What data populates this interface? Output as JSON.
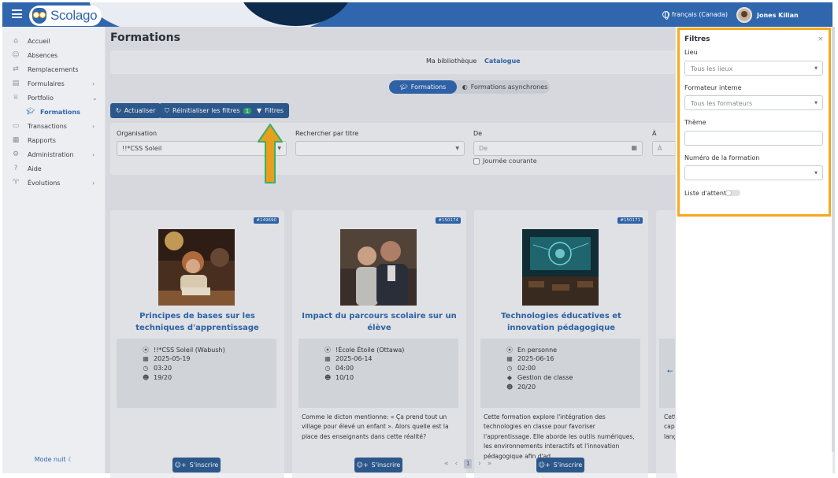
{
  "header": {
    "logo_text": "Scolago",
    "language": "français (Canada)",
    "user_name": "Jones Kilian"
  },
  "sidebar": {
    "items": [
      {
        "label": "Accueil",
        "icon": "home-icon"
      },
      {
        "label": "Absences",
        "icon": "users-icon"
      },
      {
        "label": "Remplacements",
        "icon": "swap-icon"
      },
      {
        "label": "Formulaires",
        "icon": "file-icon"
      },
      {
        "label": "Portfolio",
        "icon": "trophy-icon"
      },
      {
        "label": "Formations",
        "icon": "graduation-cap-icon"
      },
      {
        "label": "Transactions",
        "icon": "transaction-icon"
      },
      {
        "label": "Rapports",
        "icon": "report-icon"
      },
      {
        "label": "Administration",
        "icon": "gear-icon"
      },
      {
        "label": "Aide",
        "icon": "help-icon"
      },
      {
        "label": "Évolutions",
        "icon": "evolution-icon"
      }
    ],
    "mode_nuit": "Mode nuit ☾"
  },
  "page": {
    "title": "Formations",
    "library_link": "Ma bibliothèque",
    "catalogue_link": "Catalogue",
    "toggle": {
      "active": "Formations",
      "inactive": "Formations asynchrones"
    },
    "buttons": {
      "refresh": "Actualiser",
      "reset": "Réinitialiser les filtres",
      "reset_count": "1",
      "filters": "Filtres"
    },
    "filters": {
      "org_label": "Organisation",
      "org_value": "!!*CSS Soleil",
      "search_label": "Rechercher par titre",
      "search_value": "",
      "from_label": "De",
      "from_placeholder": "De",
      "to_label": "À",
      "to_placeholder": "À",
      "current_day": "Journée courante"
    }
  },
  "cards": [
    {
      "number": "#149690",
      "title": "Principes de bases sur les techniques d'apprentissage",
      "location": "!!*CSS Soleil (Wabush)",
      "date": "2025-05-19",
      "duration": "03:20",
      "seats": "19/20",
      "theme": "",
      "description": "",
      "register": "S'inscrire"
    },
    {
      "number": "#150174",
      "title": "Impact du parcours scolaire sur un élève",
      "location": "!École Étoile (Ottawa)",
      "date": "2025-06-14",
      "duration": "04:00",
      "seats": "10/10",
      "theme": "",
      "description": "Comme le dicton mentionne: « Ça prend tout un village pour élevé un enfant ». Alors quelle est la place des enseignants dans cette réalité?",
      "register": "S'inscrire"
    },
    {
      "number": "#150171",
      "title": "Technologies éducatives et innovation pédagogique",
      "location": "En personne",
      "date": "2025-06-16",
      "duration": "02:00",
      "seats": "20/20",
      "theme": "Gestion de classe",
      "description": "Cette formation explore l'intégration des technologies en classe pour favoriser l'apprentissage. Elle aborde les outils numériques, les environnements interactifs et l'innovation pédagogique afin d'ad",
      "register": "S'inscrire"
    }
  ],
  "fourth_card_desc": "Cett cap lang",
  "pager": {
    "current": "1"
  },
  "panel": {
    "title": "Filtres",
    "close": "×",
    "lieu_label": "Lieu",
    "lieu_value": "Tous les lieux",
    "formateur_label": "Formateur interne",
    "formateur_value": "Tous les formateurs",
    "theme_label": "Thème",
    "theme_value": "",
    "numero_label": "Numéro de la formation",
    "numero_value": "",
    "liste_label": "Liste d'attente",
    "liste_attente_on": false
  },
  "colors": {
    "primary": "#2f66ae",
    "button": "#2d5b92",
    "highlight": "#f6a81e",
    "arrow": "#f6a81e",
    "arrow_outline": "#41b96b"
  }
}
